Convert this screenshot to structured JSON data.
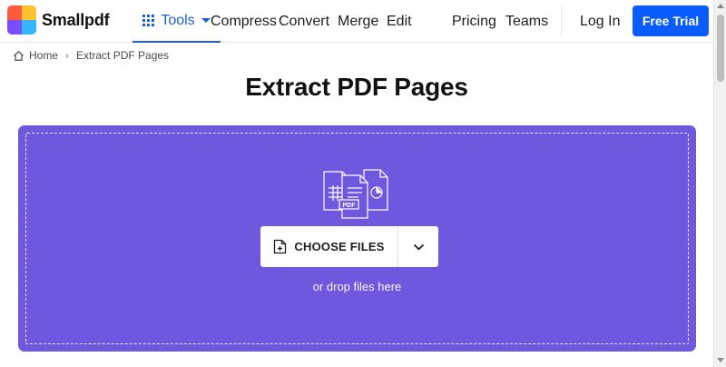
{
  "header": {
    "brand": "Smallpdf",
    "logo_colors": [
      "#ff5a3c",
      "#ffc12e",
      "#36b7ff",
      "#7a4dff"
    ],
    "nav": [
      {
        "key": "tools",
        "label": "Tools",
        "active": true
      },
      {
        "key": "compress",
        "label": "Compress"
      },
      {
        "key": "convert",
        "label": "Convert"
      },
      {
        "key": "merge",
        "label": "Merge"
      },
      {
        "key": "edit",
        "label": "Edit"
      },
      {
        "key": "pricing",
        "label": "Pricing"
      },
      {
        "key": "teams",
        "label": "Teams"
      }
    ],
    "login_label": "Log In",
    "trial_label": "Free Trial",
    "accent_color": "#0b5cff"
  },
  "breadcrumb": {
    "home": "Home",
    "separator": "›",
    "current": "Extract PDF Pages"
  },
  "page_title": "Extract PDF Pages",
  "dropzone": {
    "background": "#6f58de",
    "illustration_label": "PDF",
    "choose_label": "CHOOSE FILES",
    "drop_hint": "or drop files here"
  }
}
